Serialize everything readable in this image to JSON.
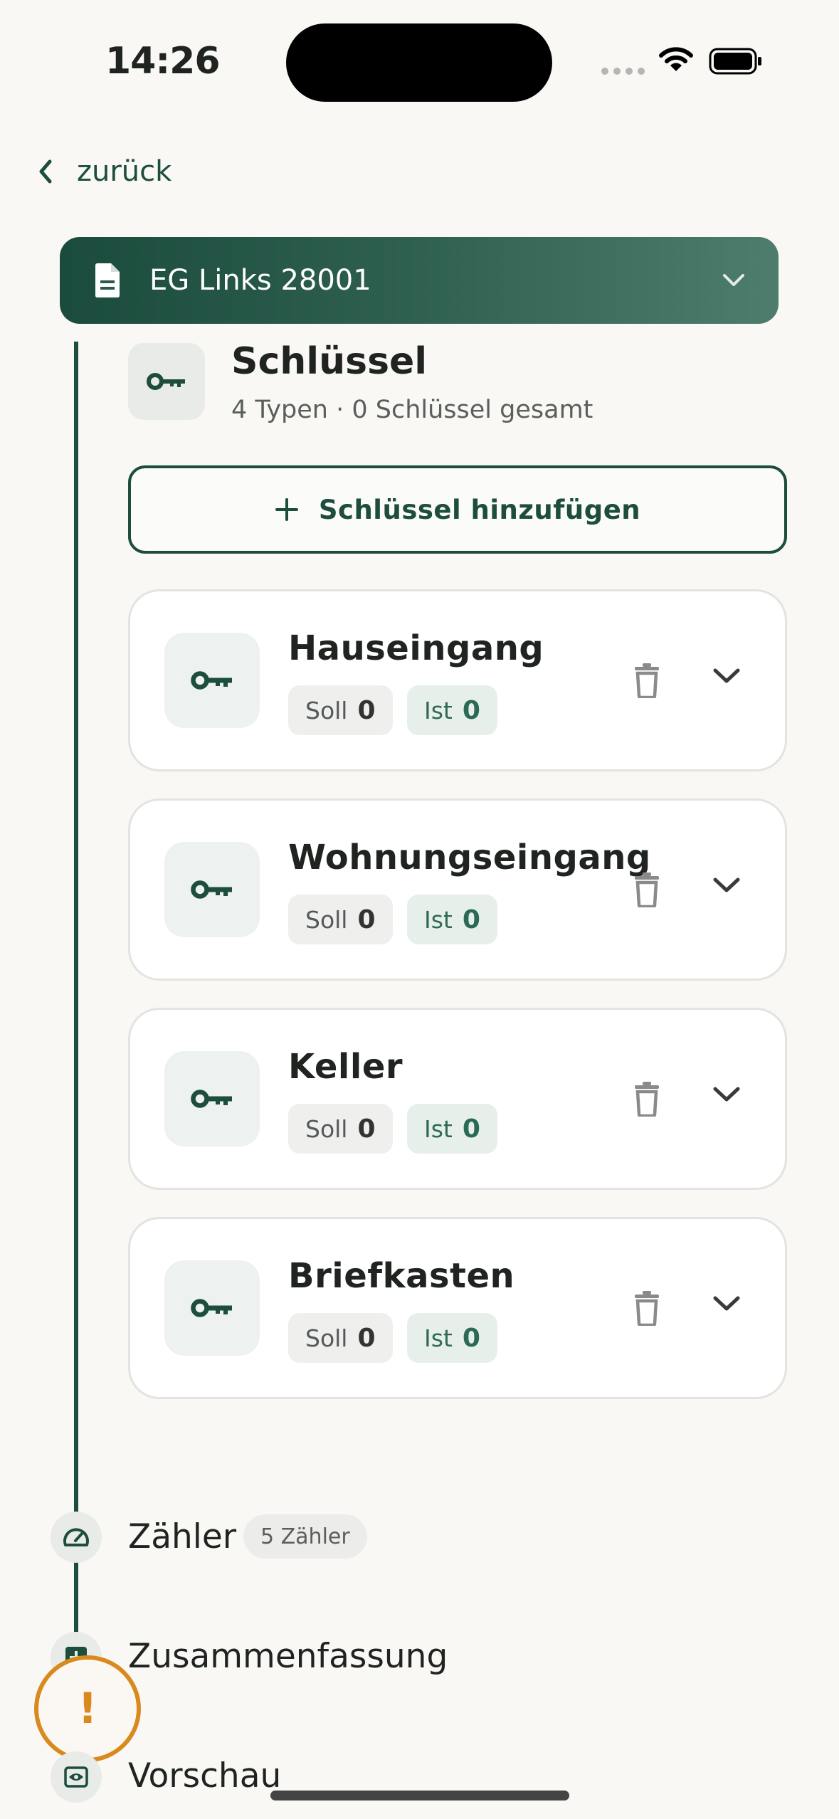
{
  "status_bar": {
    "time": "14:26"
  },
  "nav": {
    "back_label": "zurück"
  },
  "header": {
    "title": "EG Links 28001"
  },
  "section": {
    "title": "Schlüssel",
    "subtitle": "4 Typen · 0 Schlüssel gesamt",
    "add_label": "Schlüssel hinzufügen"
  },
  "keys": [
    {
      "name": "Hauseingang",
      "soll_label": "Soll",
      "soll": "0",
      "ist_label": "Ist",
      "ist": "0"
    },
    {
      "name": "Wohnungseingang",
      "soll_label": "Soll",
      "soll": "0",
      "ist_label": "Ist",
      "ist": "0"
    },
    {
      "name": "Keller",
      "soll_label": "Soll",
      "soll": "0",
      "ist_label": "Ist",
      "ist": "0"
    },
    {
      "name": "Briefkasten",
      "soll_label": "Soll",
      "soll": "0",
      "ist_label": "Ist",
      "ist": "0"
    }
  ],
  "steps": {
    "zaehler": {
      "label": "Zähler",
      "badge": "5 Zähler"
    },
    "zusammenfassung": {
      "label": "Zusammenfassung"
    },
    "vorschau": {
      "label": "Vorschau"
    }
  },
  "warning": {
    "symbol": "!"
  },
  "colors": {
    "primary": "#1c4d3d",
    "warning": "#d98a1f",
    "background": "#f9f8f5"
  }
}
